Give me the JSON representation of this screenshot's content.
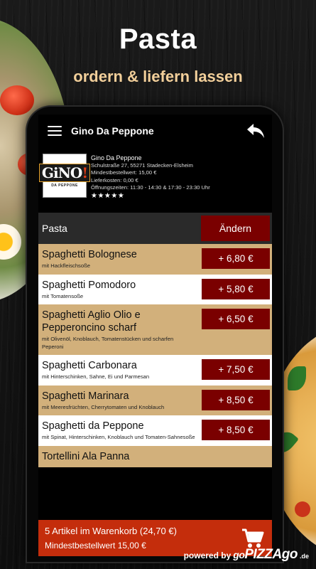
{
  "promo": {
    "title": "Pasta",
    "subtitle": "ordern & liefern lassen"
  },
  "appbar": {
    "title": "Gino Da Peppone",
    "menu_icon": "hamburger-menu-icon",
    "back_icon": "reply-arrow-icon"
  },
  "restaurant": {
    "logo_text": "GiNO!",
    "logo_subtext": "DA PEPPONE",
    "name": "Gino Da Peppone",
    "address": "Schulstraße 27, 55271 Stadecken-Elsheim",
    "min_order": "Mindestbestellwert: 15,00 €",
    "delivery_cost": "Lieferkosten: 0,00 €",
    "opening_hours": "Öffnungszeiten: 11:30 - 14:30 & 17:30 - 23:30 Uhr",
    "rating": 5,
    "stars": "★★★★★"
  },
  "category": {
    "name": "Pasta",
    "change_label": "Ändern"
  },
  "items": [
    {
      "name": "Spaghetti Bolognese",
      "desc": "mit Hackfleischsoße",
      "price": "+ 6,80 €",
      "shade": "tan"
    },
    {
      "name": "Spaghetti Pomodoro",
      "desc": "mit Tomatensoße",
      "price": "+ 5,80 €",
      "shade": "white"
    },
    {
      "name": "Spaghetti Aglio Olio e Pepperoncino scharf",
      "desc": "mit Olivenöl, Knoblauch, Tomatenstücken und scharfen Peperoni",
      "price": "+ 6,50 €",
      "shade": "tan"
    },
    {
      "name": "Spaghetti Carbonara",
      "desc": "mit Hinterschinken, Sahne, Ei und Parmesan",
      "price": "+ 7,50 €",
      "shade": "white"
    },
    {
      "name": "Spaghetti Marinara",
      "desc": "mit Meeresfrüchten, Cherrytomaten und Knoblauch",
      "price": "+ 8,50 €",
      "shade": "tan"
    },
    {
      "name": "Spaghetti da Peppone",
      "desc": "mit Spinat, Hinterschinken, Knoblauch und Tomaten-Sahnesoße",
      "price": "+ 8,50 €",
      "shade": "white"
    },
    {
      "name": "Tortellini Ala Panna",
      "desc": "",
      "price": "",
      "shade": "tan"
    }
  ],
  "cart": {
    "summary": "5 Artikel im Warenkorb (24,70 €)",
    "min_order": "Mindestbestellwert 15,00 €",
    "icon": "shopping-cart-icon"
  },
  "footer": {
    "powered_by": "powered by",
    "brand_go": "go",
    "brand_main": "PIZZAgo",
    "brand_tld": ".de"
  },
  "colors": {
    "accent_dark_red": "#7a0000",
    "cart_red": "#c42d0c",
    "tan_row": "#d2b07b",
    "subtitle_gold": "#f2cf9a"
  }
}
